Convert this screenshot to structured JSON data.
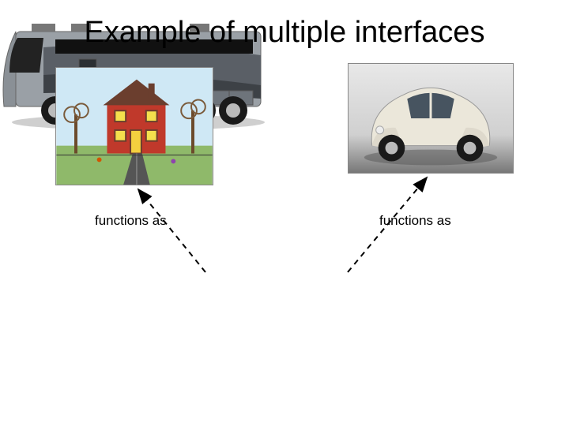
{
  "title": "Example of multiple interfaces",
  "labels": {
    "left": "functions as",
    "right": "functions as"
  },
  "images": {
    "house": {
      "alt": "house-painting"
    },
    "car": {
      "alt": "beetle-car"
    },
    "rv": {
      "alt": "motorhome-rv"
    }
  }
}
